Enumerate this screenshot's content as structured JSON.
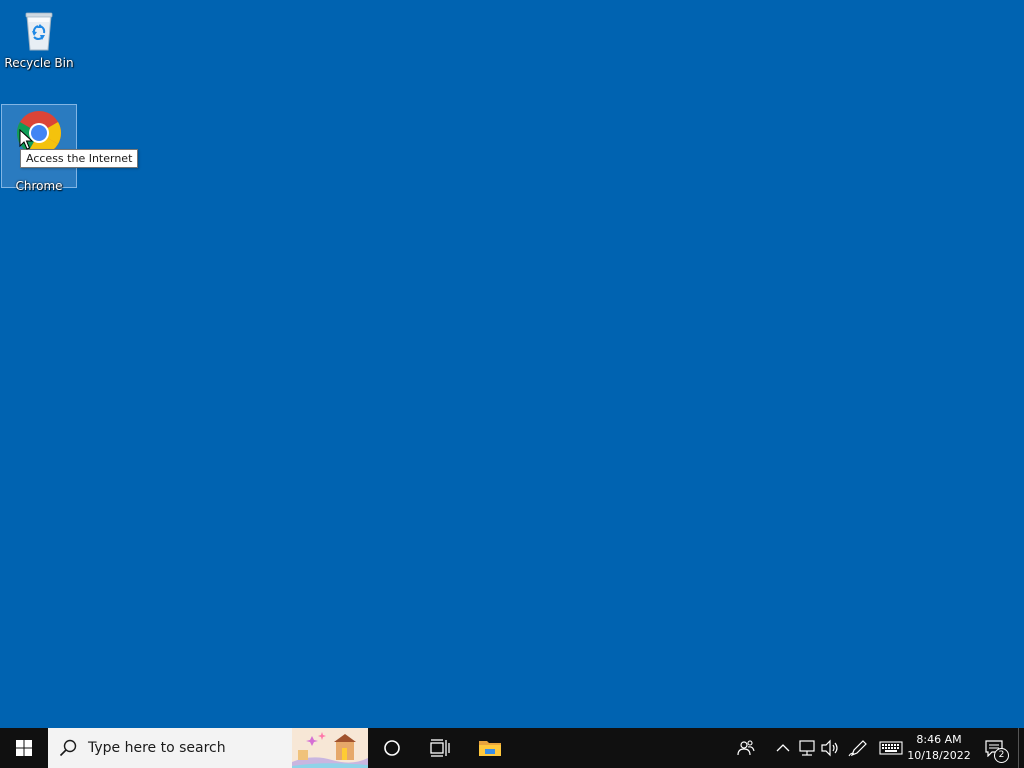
{
  "desktop": {
    "background_color": "#0063b1",
    "icons": [
      {
        "label": "Recycle Bin",
        "icon": "recycle-bin-icon"
      },
      {
        "label": "Chrome",
        "icon": "chrome-icon",
        "selected": true
      }
    ],
    "tooltip": "Access the Internet"
  },
  "taskbar": {
    "search": {
      "placeholder": "Type here to search"
    },
    "apps": [
      {
        "name": "cortana",
        "icon": "cortana-icon"
      },
      {
        "name": "task-view",
        "icon": "task-view-icon"
      },
      {
        "name": "file-explorer",
        "icon": "folder-icon"
      }
    ],
    "tray": {
      "icons": [
        "people-icon",
        "chevron-up-icon",
        "network-icon",
        "volume-icon",
        "pen-icon",
        "keyboard-icon"
      ],
      "time": "8:46 AM",
      "date": "10/18/2022",
      "notification_count": "2"
    }
  }
}
